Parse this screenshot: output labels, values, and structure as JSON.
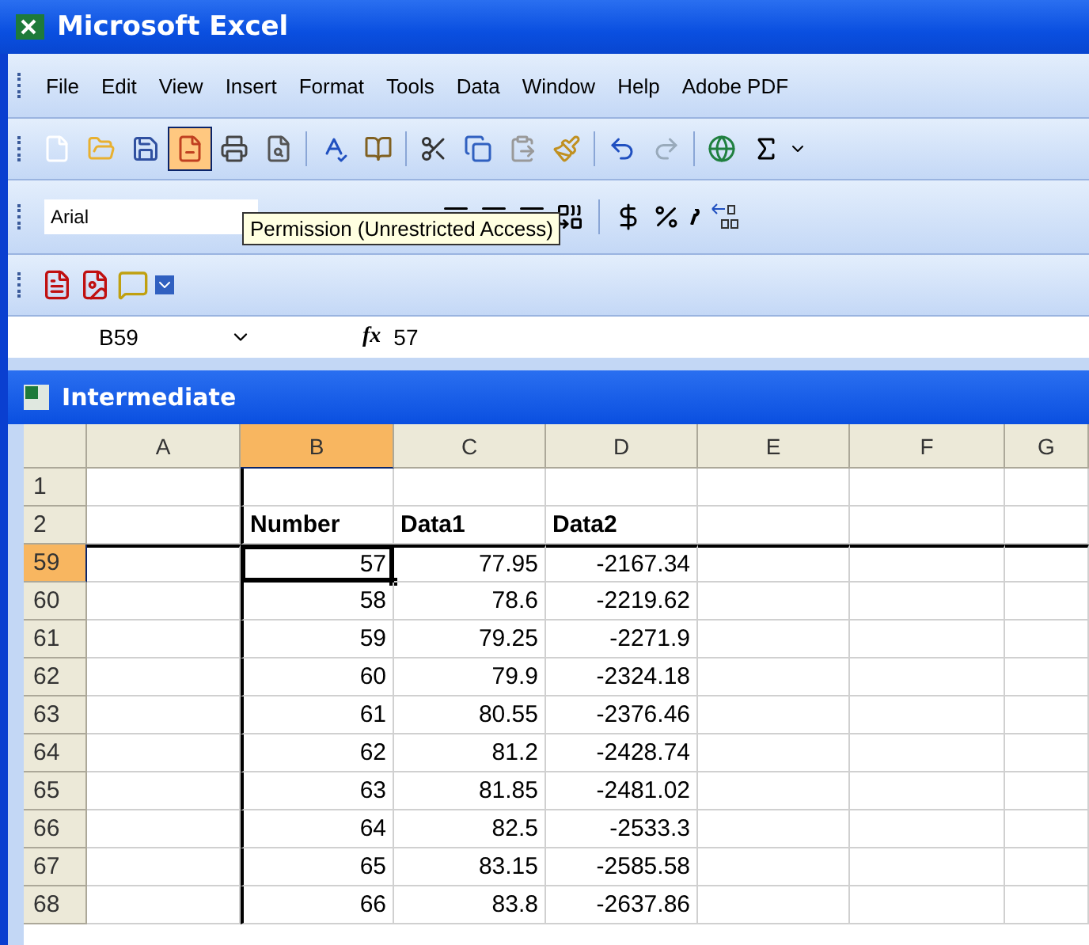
{
  "window": {
    "title": "Microsoft Excel"
  },
  "menu": [
    "File",
    "Edit",
    "View",
    "Insert",
    "Format",
    "Tools",
    "Data",
    "Window",
    "Help",
    "Adobe PDF"
  ],
  "font_box": {
    "value": "Arial"
  },
  "tooltip": "Permission (Unrestricted Access)",
  "formula_bar": {
    "name_box": "B59",
    "function_label": "fx",
    "value": "57"
  },
  "workbook": {
    "title": "Intermediate"
  },
  "columns": [
    {
      "label": "A",
      "selected": false
    },
    {
      "label": "B",
      "selected": true
    },
    {
      "label": "C",
      "selected": false
    },
    {
      "label": "D",
      "selected": false
    },
    {
      "label": "E",
      "selected": false
    },
    {
      "label": "F",
      "selected": false
    },
    {
      "label": "G",
      "selected": false
    }
  ],
  "rows": [
    {
      "header": "1",
      "selected": false,
      "kind": "data",
      "cells": [
        "",
        "",
        "",
        "",
        "",
        "",
        ""
      ]
    },
    {
      "header": "2",
      "selected": false,
      "kind": "heading",
      "cells": [
        "",
        "Number",
        "Data1",
        "Data2",
        "",
        "",
        ""
      ]
    },
    {
      "header": "59",
      "selected": true,
      "kind": "data",
      "cells": [
        "",
        "57",
        "77.95",
        "-2167.34",
        "",
        "",
        ""
      ]
    },
    {
      "header": "60",
      "selected": false,
      "kind": "data",
      "cells": [
        "",
        "58",
        "78.6",
        "-2219.62",
        "",
        "",
        ""
      ]
    },
    {
      "header": "61",
      "selected": false,
      "kind": "data",
      "cells": [
        "",
        "59",
        "79.25",
        "-2271.9",
        "",
        "",
        ""
      ]
    },
    {
      "header": "62",
      "selected": false,
      "kind": "data",
      "cells": [
        "",
        "60",
        "79.9",
        "-2324.18",
        "",
        "",
        ""
      ]
    },
    {
      "header": "63",
      "selected": false,
      "kind": "data",
      "cells": [
        "",
        "61",
        "80.55",
        "-2376.46",
        "",
        "",
        ""
      ]
    },
    {
      "header": "64",
      "selected": false,
      "kind": "data",
      "cells": [
        "",
        "62",
        "81.2",
        "-2428.74",
        "",
        "",
        ""
      ]
    },
    {
      "header": "65",
      "selected": false,
      "kind": "data",
      "cells": [
        "",
        "63",
        "81.85",
        "-2481.02",
        "",
        "",
        ""
      ]
    },
    {
      "header": "66",
      "selected": false,
      "kind": "data",
      "cells": [
        "",
        "64",
        "82.5",
        "-2533.3",
        "",
        "",
        ""
      ]
    },
    {
      "header": "67",
      "selected": false,
      "kind": "data",
      "cells": [
        "",
        "65",
        "83.15",
        "-2585.58",
        "",
        "",
        ""
      ]
    },
    {
      "header": "68",
      "selected": false,
      "kind": "data",
      "cells": [
        "",
        "66",
        "83.8",
        "-2637.86",
        "",
        "",
        ""
      ]
    }
  ]
}
